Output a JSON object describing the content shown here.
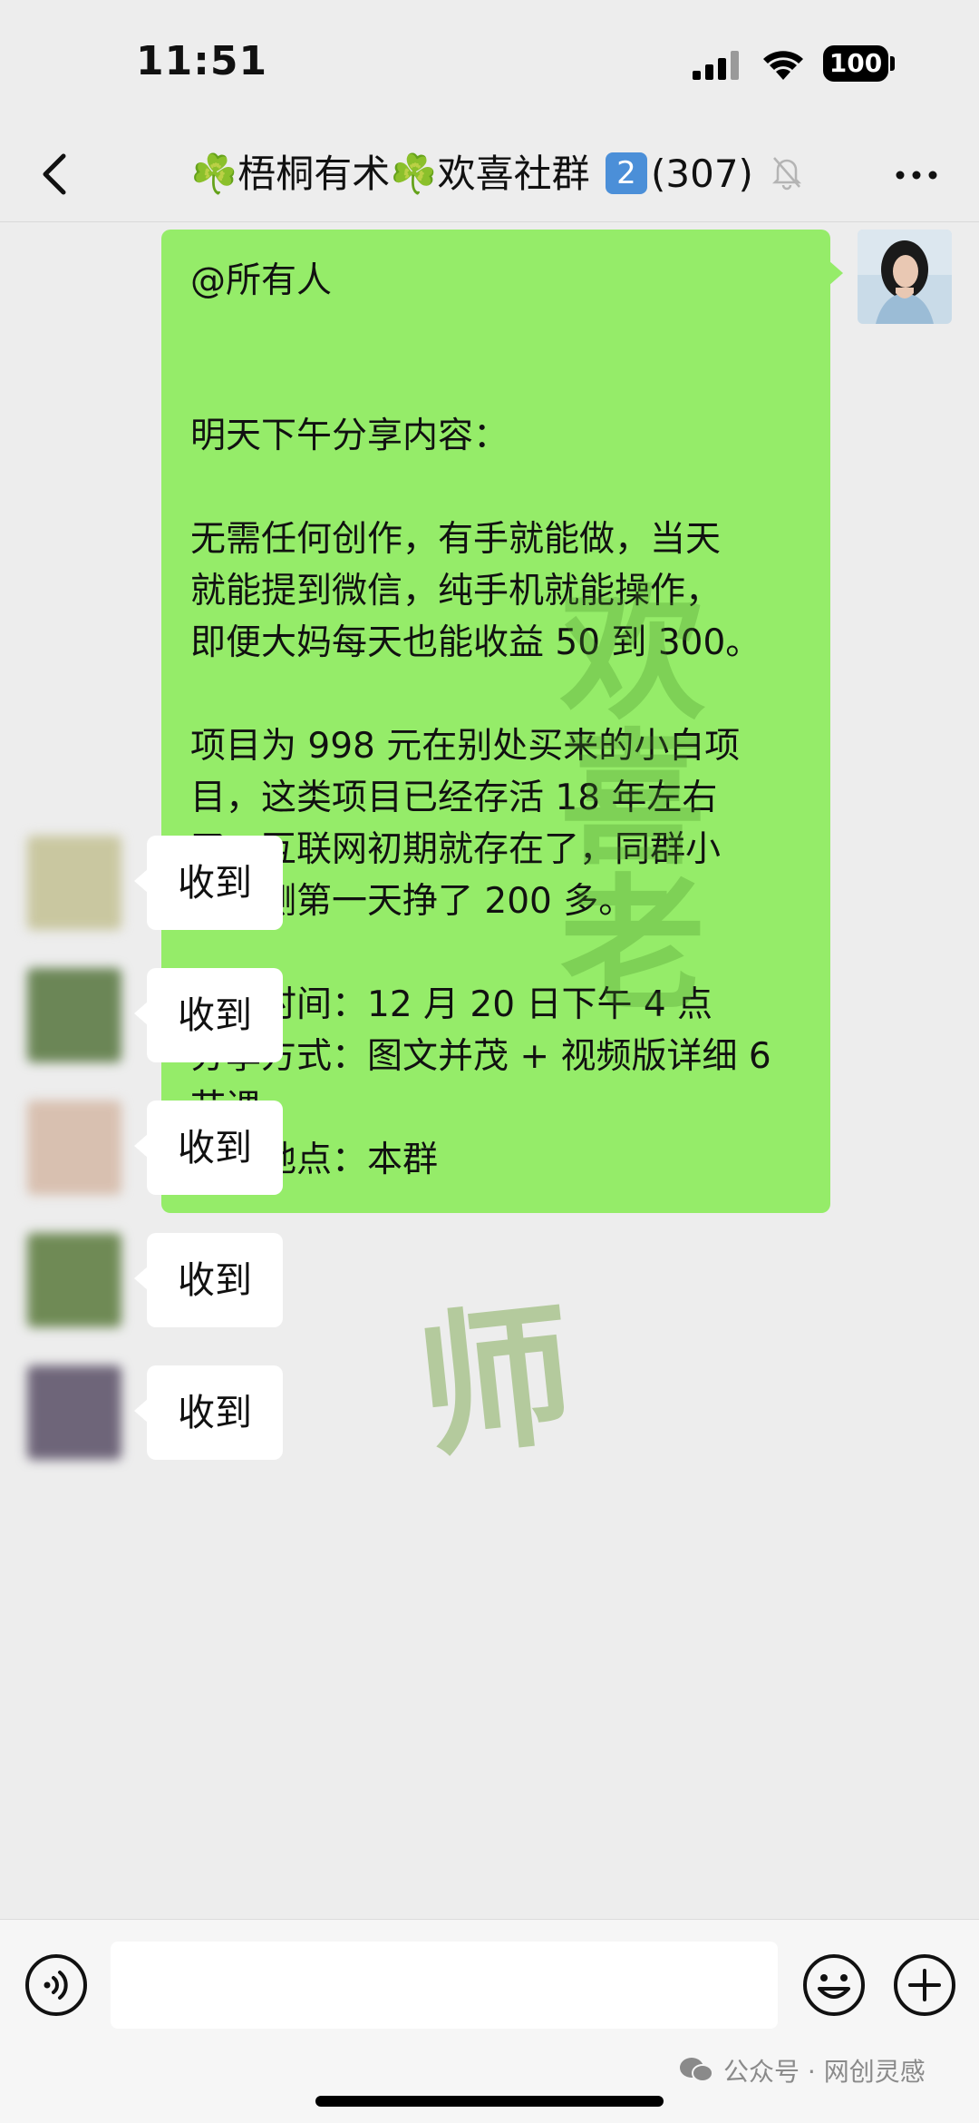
{
  "status_bar": {
    "time": "11:51",
    "battery": "100"
  },
  "nav": {
    "clover": "☘️",
    "group_name_part1": "梧桐有术",
    "group_name_part2": "欢喜社群",
    "group_number": "2",
    "member_count": "(307)"
  },
  "message_out": {
    "lines": [
      "@所有人",
      "",
      "",
      "明天下午分享内容：",
      "",
      "无需任何创作，有手就能做，当天",
      "就能提到微信，纯手机就能操作，",
      "即便大妈每天也能收益 50 到 300。",
      "",
      "项目为 998 元在别处买来的小白项",
      "目，这类项目已经存活 18 年左右",
      "了，互联网初期就存在了，同群小",
      "白亲测第一天挣了 200 多。",
      "",
      "分享时间：12 月 20 日下午 4 点",
      "分享方式：图文并茂 + 视频版详细 6",
      "节课",
      "分享地点：本群"
    ],
    "watermark": [
      "欢",
      "喜",
      "老",
      "师"
    ]
  },
  "replies": [
    {
      "text": "收到",
      "avatar_color": "#c9c7a0"
    },
    {
      "text": "收到",
      "avatar_color": "#6b8656"
    },
    {
      "text": "收到",
      "avatar_color": "#d8c0b0"
    },
    {
      "text": "收到",
      "avatar_color": "#6f8a55"
    },
    {
      "text": "收到",
      "avatar_color": "#6e6579"
    }
  ],
  "input": {
    "placeholder": ""
  },
  "footer": {
    "watermark": "公众号 · 网创灵感"
  },
  "colors": {
    "bubble_out": "#95ec69",
    "background": "#ededed",
    "bubble_in": "#ffffff"
  }
}
